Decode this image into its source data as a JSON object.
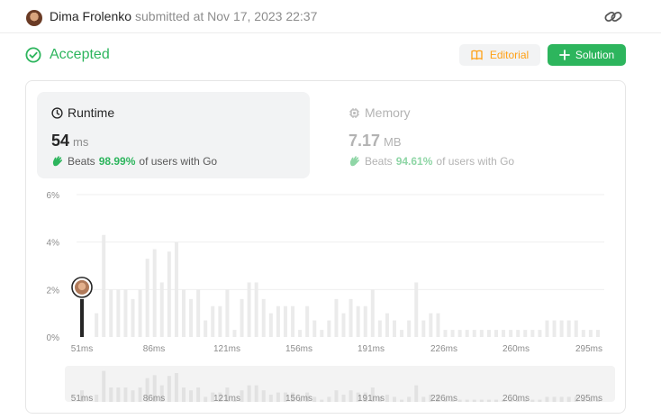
{
  "header": {
    "author": "Dima Frolenko",
    "submitted": "submitted at Nov 17, 2023 22:37"
  },
  "status": {
    "label": "Accepted",
    "color": "#2db55d"
  },
  "buttons": {
    "editorial": "Editorial",
    "solution": "Solution"
  },
  "runtime": {
    "label": "Runtime",
    "value": "54",
    "unit": "ms",
    "beats_prefix": "Beats",
    "beats_pct": "98.99%",
    "beats_suffix": "of users with Go"
  },
  "memory": {
    "label": "Memory",
    "value": "7.17",
    "unit": "MB",
    "beats_prefix": "Beats",
    "beats_pct": "94.61%",
    "beats_suffix": "of users with Go"
  },
  "chart_data": {
    "type": "bar",
    "ylabel": "",
    "xlabel": "",
    "y_tick_labels": [
      "0%",
      "2%",
      "4%",
      "6%"
    ],
    "ylim": [
      0,
      6
    ],
    "x_tick_labels": [
      "51ms",
      "86ms",
      "121ms",
      "156ms",
      "191ms",
      "226ms",
      "260ms",
      "295ms"
    ],
    "values": [
      1.6,
      0,
      1.0,
      4.3,
      2.0,
      2.0,
      2.0,
      1.6,
      2.0,
      3.3,
      3.7,
      2.3,
      3.6,
      4.0,
      2.0,
      1.6,
      2.0,
      0.7,
      1.3,
      1.3,
      2.0,
      0.3,
      1.6,
      2.3,
      2.3,
      1.6,
      1.0,
      1.3,
      1.3,
      1.3,
      0.3,
      1.3,
      0.7,
      0.3,
      0.7,
      1.6,
      1.0,
      1.6,
      1.3,
      1.3,
      2.0,
      0.7,
      1.0,
      0.7,
      0.3,
      0.7,
      2.3,
      0.7,
      1.0,
      1.0,
      0.3,
      0.3,
      0.3,
      0.3,
      0.3,
      0.3,
      0.3,
      0.3,
      0.3,
      0.3,
      0.3,
      0.3,
      0.3,
      0.3,
      0.7,
      0.7,
      0.7,
      0.7,
      0.7,
      0.3,
      0.3,
      0.3
    ],
    "highlight_index": 0,
    "bar_color": "#ebebeb",
    "highlight_color": "#262626"
  }
}
